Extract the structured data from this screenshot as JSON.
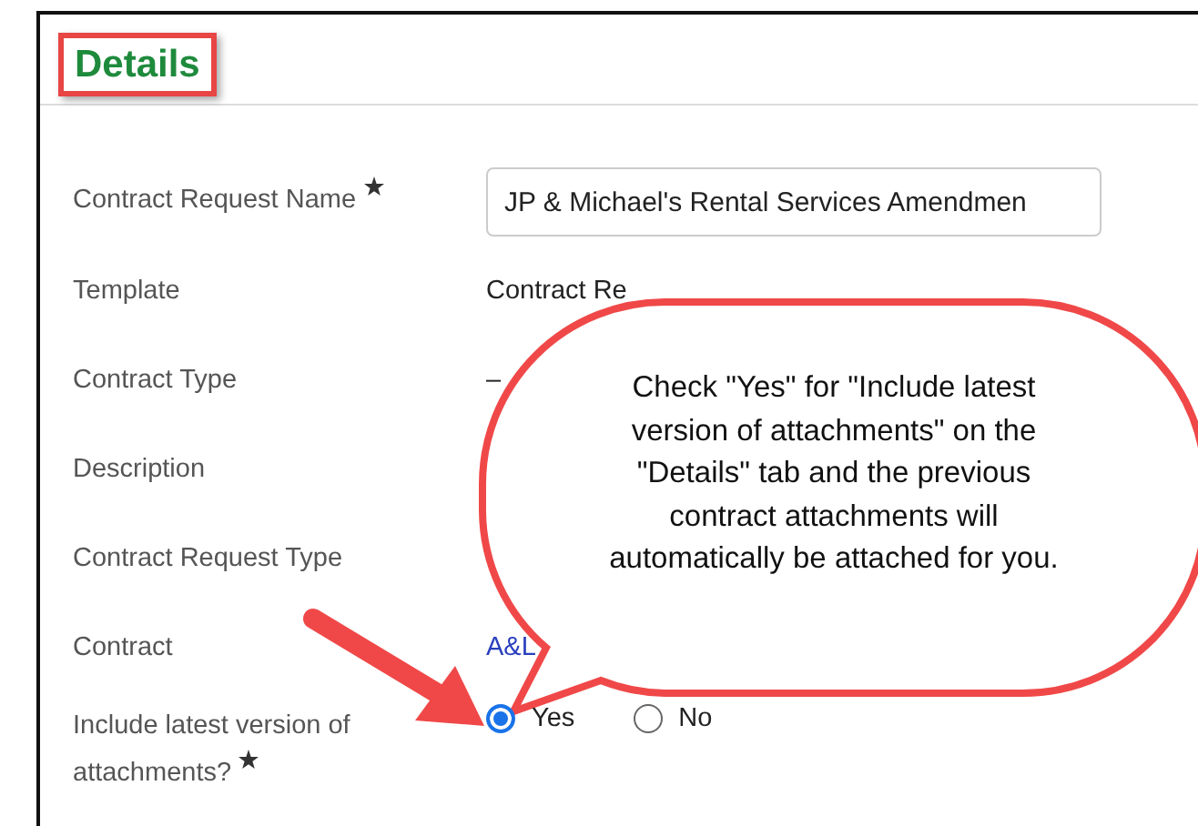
{
  "header": {
    "title": "Details"
  },
  "fields": [
    {
      "kind": "input",
      "label": "Contract Request Name",
      "required": true,
      "value": "JP & Michael's Rental Services Amendmen"
    },
    {
      "kind": "text",
      "label": "Template",
      "required": false,
      "value": "Contract Re"
    },
    {
      "kind": "text",
      "label": "Contract Type",
      "required": false,
      "value": "–"
    },
    {
      "kind": "text",
      "label": "Description",
      "required": false
    },
    {
      "kind": "text",
      "label": "Contract Request Type",
      "required": false
    },
    {
      "kind": "link",
      "label": "Contract",
      "required": false,
      "value": "A&L"
    },
    {
      "kind": "radio",
      "label": "Include latest version of attachments?",
      "required": true,
      "options": [
        {
          "label": "Yes",
          "selected": true
        },
        {
          "label": "No",
          "selected": false
        }
      ]
    }
  ],
  "callout": {
    "text": "Check \"Yes\" for \"Include latest version of attachments\" on the \"Details\" tab and the previous contract attachments will automatically be attached for you."
  }
}
